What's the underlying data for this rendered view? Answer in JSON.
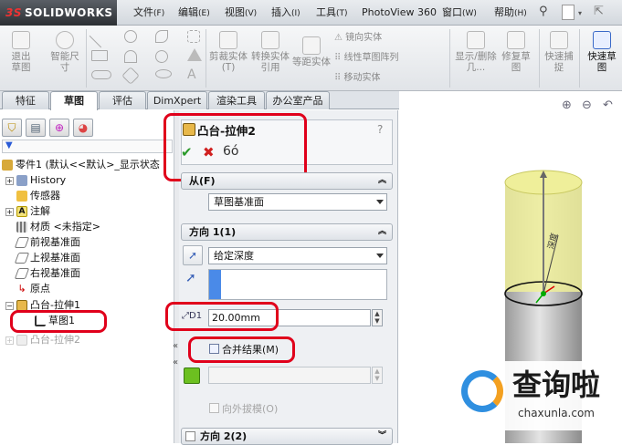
{
  "app": {
    "brand_prefix": "3S",
    "brand": "SOLIDWORKS"
  },
  "menu": [
    {
      "label": "文件",
      "key": "(F)"
    },
    {
      "label": "编辑",
      "key": "(E)"
    },
    {
      "label": "视图",
      "key": "(V)"
    },
    {
      "label": "插入",
      "key": "(I)"
    },
    {
      "label": "工具",
      "key": "(T)"
    },
    {
      "label": "PhotoView 360",
      "key": ""
    },
    {
      "label": "窗口",
      "key": "(W)"
    },
    {
      "label": "帮助",
      "key": "(H)"
    }
  ],
  "ribbon": {
    "exit_sketch": "退出草图",
    "smart_dim": "智能尺寸",
    "trim": "剪裁实体(T)",
    "convert": "转换实体引用",
    "offset": "等距实体",
    "mirror": "镜向实体",
    "linear_array": "线性草图阵列",
    "move": "移动实体",
    "show_delete": "显示/删除几...",
    "repair": "修复草图",
    "quick_snap": "快速捕捉",
    "quick_sketch": "快速草图"
  },
  "tabs": [
    "特征",
    "草图",
    "评估",
    "DimXpert",
    "渲染工具",
    "办公室产品"
  ],
  "tree": {
    "root": "零件1 (默认<<默认>_显示状态",
    "items": [
      "History",
      "传感器",
      "注解",
      "材质 <未指定>",
      "前视基准面",
      "上视基准面",
      "右视基准面",
      "原点",
      "凸台-拉伸1",
      "草图1",
      "凸台-拉伸2"
    ]
  },
  "pm": {
    "title": "凸台-拉伸2",
    "help": "?",
    "from_header": "从(F)",
    "from_value": "草图基准面",
    "dir1_header": "方向 1(1)",
    "end_condition": "给定深度",
    "depth": "20.00mm",
    "merge_label": "合并结果(M)",
    "draft_label": "向外拔模(O)",
    "dir2_header": "方向 2(2)"
  },
  "viewport": {
    "dim_label": "深度"
  },
  "watermark": {
    "title": "查询啦",
    "url": "chaxunla.com"
  },
  "colors": {
    "accent_red": "#e0001b",
    "logo_red": "#e33",
    "cylinder_top": "#efef9a"
  }
}
